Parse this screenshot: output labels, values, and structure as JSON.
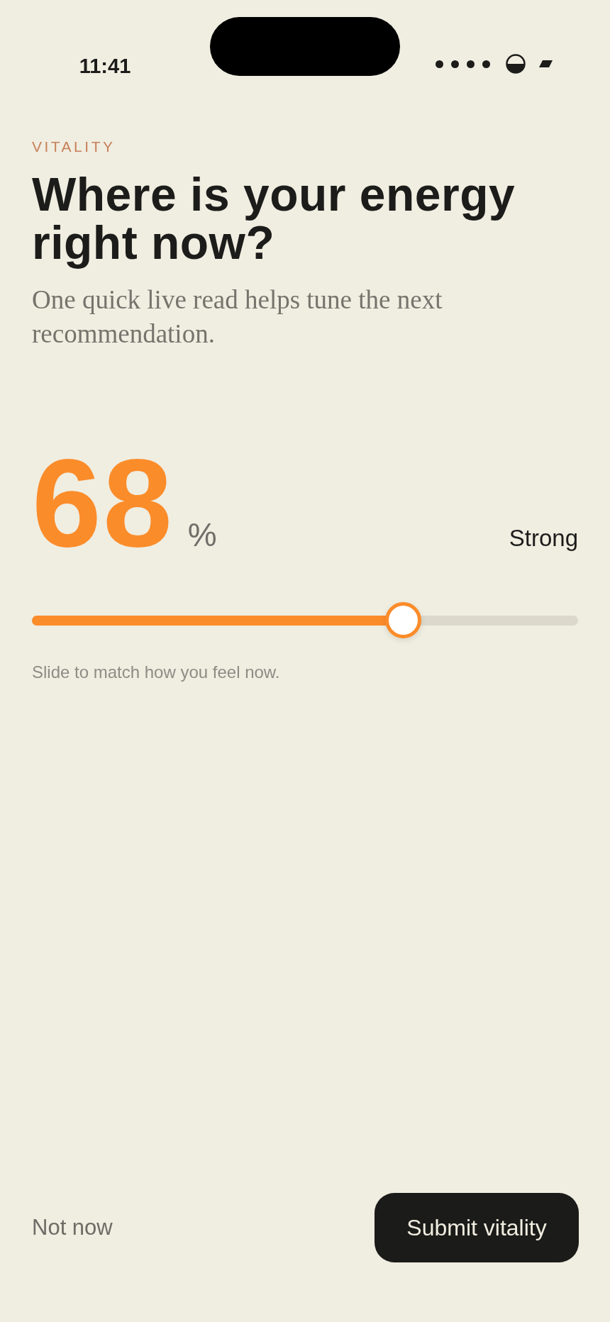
{
  "status_bar": {
    "time": "11:41"
  },
  "eyebrow": "VITALITY",
  "title": "Where is your energy right now?",
  "subtitle": "One quick live read helps tune the next recommendation.",
  "reading": {
    "value": "68",
    "unit": "%",
    "label": "Strong"
  },
  "slider": {
    "level": 0.68
  },
  "hint": "Slide to match how you feel now.",
  "actions": [
    {
      "label": "Not now",
      "kind": "secondary"
    },
    {
      "label": "Submit vitality",
      "kind": "primary"
    }
  ]
}
